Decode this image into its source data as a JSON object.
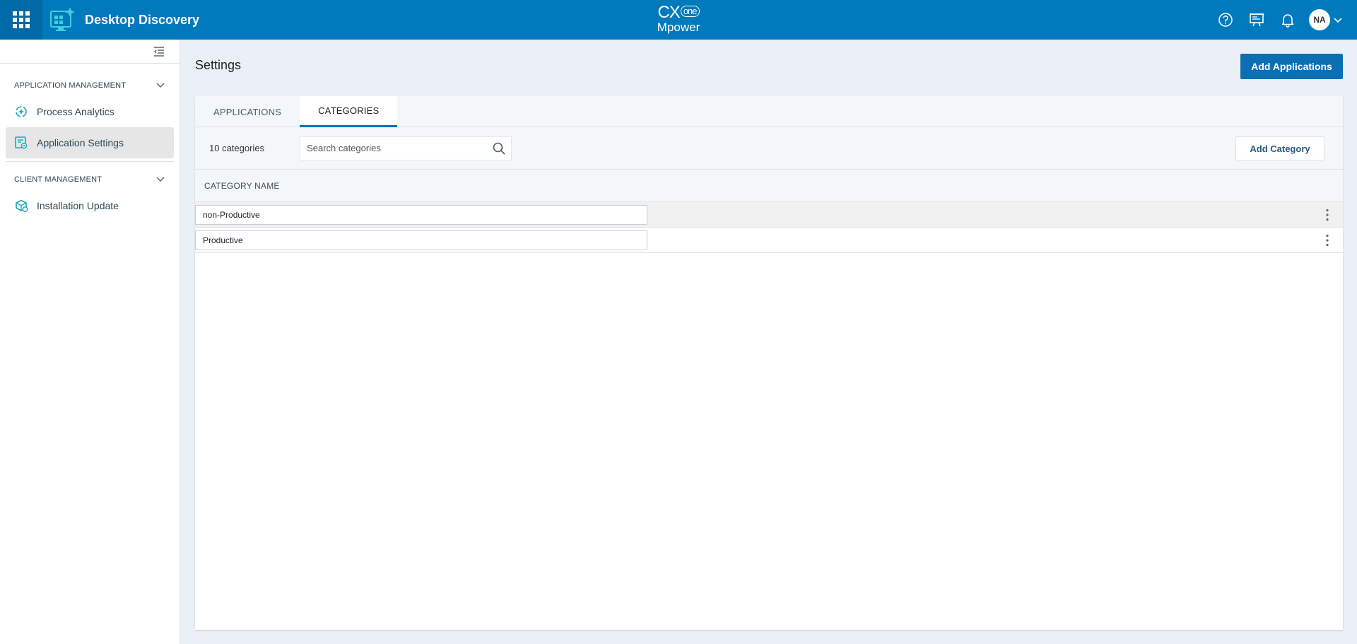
{
  "app": {
    "title": "Desktop Discovery",
    "brand_top": "CX",
    "brand_one": "one",
    "brand_bottom": "Mpower",
    "accent": "#0079bd"
  },
  "header": {
    "icons": [
      "grid-icon",
      "help-icon",
      "presentation-icon",
      "bell-icon"
    ],
    "avatar_initials": "NA"
  },
  "sidebar": {
    "sections": [
      {
        "title": "APPLICATION MANAGEMENT",
        "items": [
          {
            "label": "Process Analytics",
            "icon": "process-analytics-icon"
          },
          {
            "label": "Application Settings",
            "icon": "application-settings-icon",
            "active": true
          }
        ]
      },
      {
        "title": "CLIENT MANAGEMENT",
        "items": [
          {
            "label": "Installation Update",
            "icon": "installation-update-icon"
          }
        ]
      }
    ]
  },
  "page": {
    "title": "Settings",
    "add_applications_label": "Add Applications"
  },
  "tabs": [
    {
      "label": "APPLICATIONS",
      "active": false
    },
    {
      "label": "CATEGORIES",
      "active": true
    }
  ],
  "toolbar": {
    "count_label": "10 categories",
    "search_placeholder": "Search categories",
    "search_value": "",
    "add_category_label": "Add Category"
  },
  "table": {
    "column_header": "CATEGORY NAME",
    "rows": [
      {
        "name": "non-Productive"
      },
      {
        "name": "Productive"
      }
    ]
  }
}
